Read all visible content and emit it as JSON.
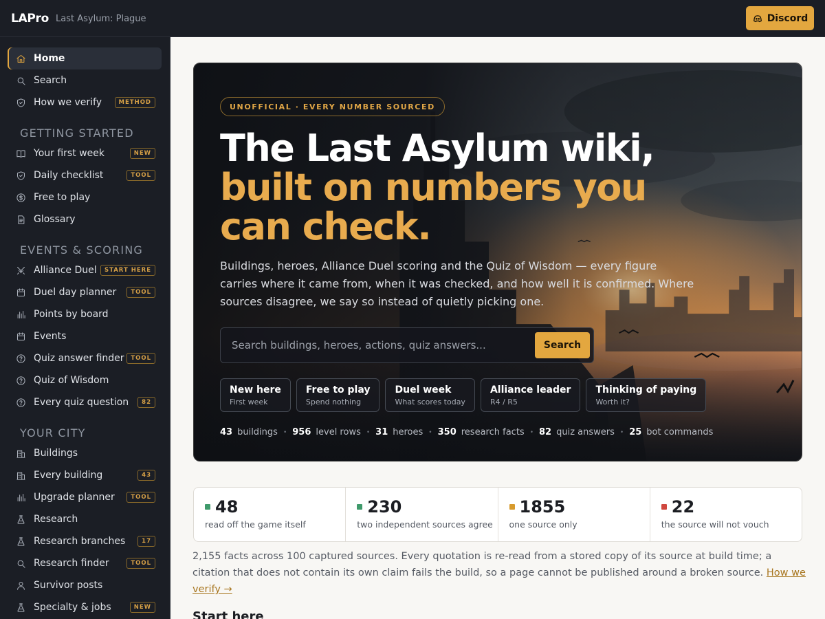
{
  "header": {
    "brand": "LAPro",
    "subtitle": "Last Asylum: Plague",
    "discord_label": "Discord"
  },
  "sidebar": {
    "top": [
      {
        "label": "Home",
        "icon": "home-icon",
        "active": true
      },
      {
        "label": "Search",
        "icon": "search-icon"
      },
      {
        "label": "How we verify",
        "icon": "shield-icon",
        "tag": "METHOD"
      }
    ],
    "sections": [
      {
        "title": "GETTING STARTED",
        "items": [
          {
            "label": "Your first week",
            "icon": "book-icon",
            "tag": "NEW"
          },
          {
            "label": "Daily checklist",
            "icon": "shield-check-icon",
            "tag": "TOOL"
          },
          {
            "label": "Free to play",
            "icon": "dollar-icon"
          },
          {
            "label": "Glossary",
            "icon": "document-icon"
          }
        ]
      },
      {
        "title": "EVENTS & SCORING",
        "items": [
          {
            "label": "Alliance Duel",
            "icon": "swords-icon",
            "tag": "START HERE"
          },
          {
            "label": "Duel day planner",
            "icon": "calendar-icon",
            "tag": "TOOL"
          },
          {
            "label": "Points by board",
            "icon": "bar-chart-icon"
          },
          {
            "label": "Events",
            "icon": "calendar-icon"
          },
          {
            "label": "Quiz answer finder",
            "icon": "help-circle-icon",
            "tag": "TOOL"
          },
          {
            "label": "Quiz of Wisdom",
            "icon": "help-circle-icon"
          },
          {
            "label": "Every quiz question",
            "icon": "help-circle-icon",
            "tag": "82"
          }
        ]
      },
      {
        "title": "YOUR CITY",
        "items": [
          {
            "label": "Buildings",
            "icon": "building-icon"
          },
          {
            "label": "Every building",
            "icon": "building-icon",
            "tag": "43"
          },
          {
            "label": "Upgrade planner",
            "icon": "bar-chart-icon",
            "tag": "TOOL"
          },
          {
            "label": "Research",
            "icon": "flask-icon"
          },
          {
            "label": "Research branches",
            "icon": "flask-icon",
            "tag": "17"
          },
          {
            "label": "Research finder",
            "icon": "search-icon",
            "tag": "TOOL"
          },
          {
            "label": "Survivor posts",
            "icon": "user-icon"
          },
          {
            "label": "Specialty & jobs",
            "icon": "flask-icon",
            "tag": "NEW"
          }
        ]
      }
    ]
  },
  "hero": {
    "pill": "UNOFFICIAL · EVERY NUMBER SOURCED",
    "title_line1": "The Last Asylum wiki,",
    "title_line2": "built on numbers you",
    "title_line3": "can check.",
    "lede": "Buildings, heroes, Alliance Duel scoring and the Quiz of Wisdom — every figure carries where it came from, when it was checked, and how well it is confirmed. Where sources disagree, we say so instead of quietly picking one.",
    "search_placeholder": "Search buildings, heroes, actions, quiz answers...",
    "search_button": "Search",
    "chips": [
      {
        "title": "New here",
        "sub": "First week"
      },
      {
        "title": "Free to play",
        "sub": "Spend nothing"
      },
      {
        "title": "Duel week",
        "sub": "What scores today"
      },
      {
        "title": "Alliance leader",
        "sub": "R4 / R5"
      },
      {
        "title": "Thinking of paying",
        "sub": "Worth it?"
      }
    ],
    "stats": [
      {
        "n": "43",
        "label": "buildings"
      },
      {
        "n": "956",
        "label": "level rows"
      },
      {
        "n": "31",
        "label": "heroes"
      },
      {
        "n": "350",
        "label": "research facts"
      },
      {
        "n": "82",
        "label": "quiz answers"
      },
      {
        "n": "25",
        "label": "bot commands"
      }
    ]
  },
  "confidence": [
    {
      "value": "48",
      "label": "read off the game itself",
      "color": "#3f9a6b"
    },
    {
      "value": "230",
      "label": "two independent sources agree",
      "color": "#3f9a6b"
    },
    {
      "value": "1855",
      "label": "one source only",
      "color": "#d79a2c"
    },
    {
      "value": "22",
      "label": "the source will not vouch",
      "color": "#d0473f"
    }
  ],
  "note": {
    "text": "2,155 facts across 100 captured sources. Every quotation is re-read from a stored copy of its source at build time; a citation that does not contain its own claim fails the build, so a page cannot be published around a broken source. ",
    "link": "How we verify →"
  },
  "start_heading": "Start here"
}
